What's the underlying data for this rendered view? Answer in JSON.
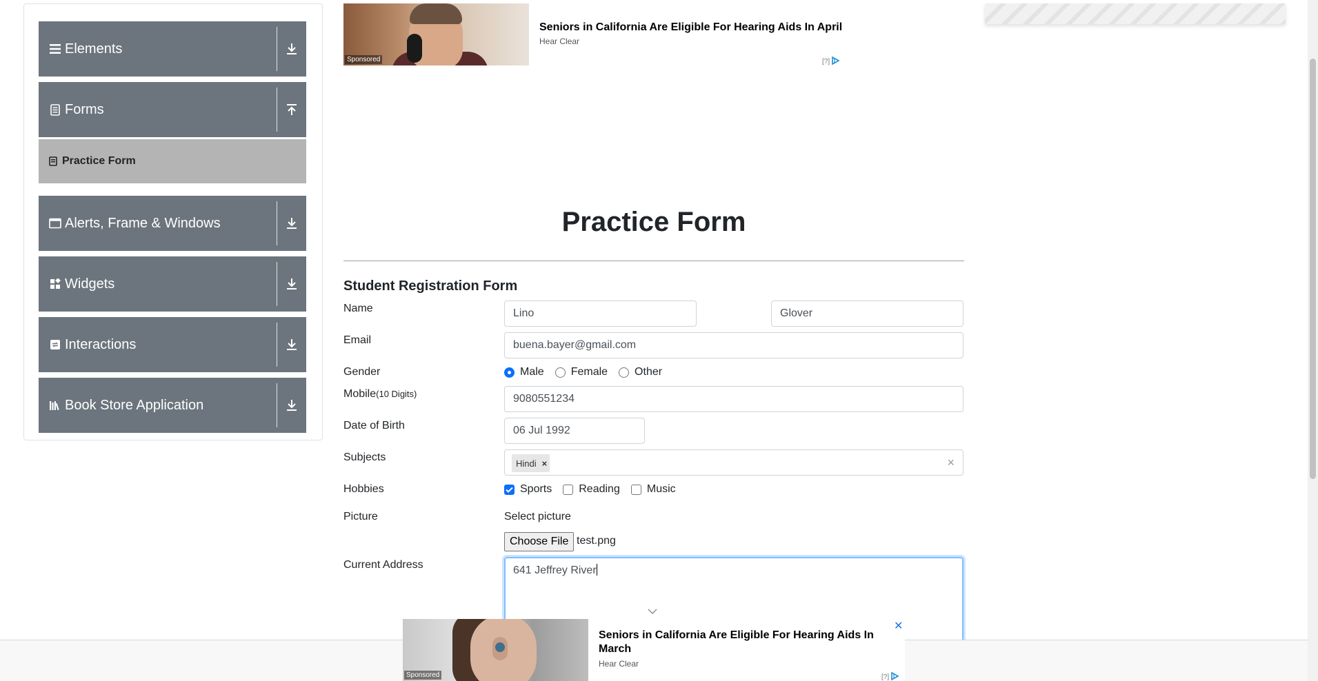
{
  "sidebar": {
    "groups": [
      {
        "label": "Elements",
        "icon": "hamburger-icon",
        "arrow": "download-arrow-icon"
      },
      {
        "label": "Forms",
        "icon": "document-icon",
        "arrow": "upload-arrow-icon"
      },
      {
        "label": "Alerts, Frame & Windows",
        "icon": "window-icon",
        "arrow": "download-arrow-icon"
      },
      {
        "label": "Widgets",
        "icon": "widgets-icon",
        "arrow": "download-arrow-icon"
      },
      {
        "label": "Interactions",
        "icon": "interactions-icon",
        "arrow": "download-arrow-icon"
      },
      {
        "label": "Book Store Application",
        "icon": "books-icon",
        "arrow": "download-arrow-icon"
      }
    ],
    "active_item": {
      "label": "Practice Form",
      "icon": "form-icon"
    }
  },
  "top_ad": {
    "title": "Seniors in California Are Eligible For Hearing Aids In April",
    "source": "Hear Clear",
    "sponsored": "Sponsored",
    "choice": "[?]"
  },
  "page": {
    "title": "Practice Form",
    "form_title": "Student Registration Form"
  },
  "form": {
    "name_label": "Name",
    "first_name": "Lino",
    "last_name": "Glover",
    "email_label": "Email",
    "email": "buena.bayer@gmail.com",
    "gender_label": "Gender",
    "gender_options": [
      "Male",
      "Female",
      "Other"
    ],
    "gender_selected": "Male",
    "mobile_label": "Mobile",
    "mobile_hint": "(10 Digits)",
    "mobile": "9080551234",
    "dob_label": "Date of Birth",
    "dob": "06 Jul 1992",
    "subjects_label": "Subjects",
    "subjects": [
      "Hindi"
    ],
    "subjects_remove": "×",
    "subjects_clear": "×",
    "hobbies_label": "Hobbies",
    "hobbies": [
      {
        "label": "Sports",
        "checked": true
      },
      {
        "label": "Reading",
        "checked": false
      },
      {
        "label": "Music",
        "checked": false
      }
    ],
    "picture_label": "Picture",
    "select_picture": "Select picture",
    "choose_file": "Choose File",
    "file_name": "test.png",
    "address_label": "Current Address",
    "address": "641 Jeffrey River"
  },
  "bottom_ad": {
    "title": "Seniors in California Are Eligible For Hearing Aids In March",
    "source": "Hear Clear",
    "sponsored": "Sponsored",
    "close": "✕",
    "choice": "[?]"
  },
  "colors": {
    "sidebar_group": "#6c757d",
    "sidebar_active": "#b4b4b4",
    "accent": "#0d6efd",
    "focus_border": "#80bdff"
  }
}
